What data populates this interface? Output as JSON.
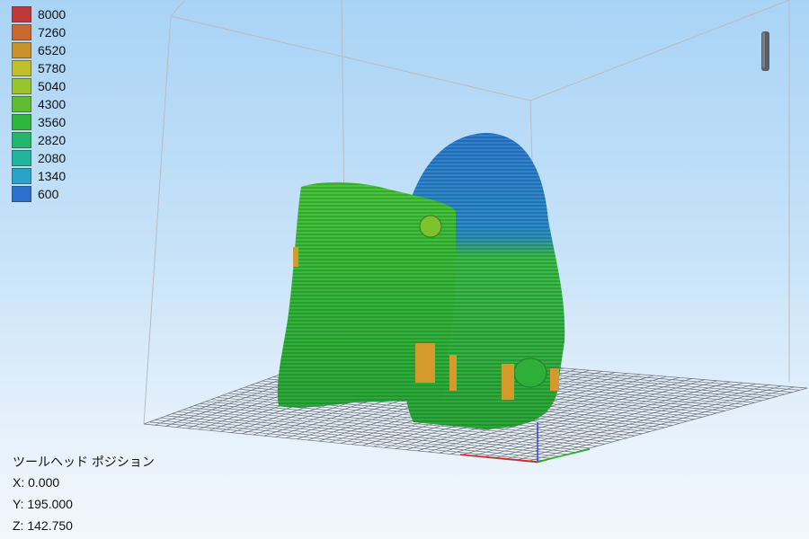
{
  "legend": {
    "items": [
      {
        "label": "8000",
        "color": "#c0393a"
      },
      {
        "label": "7260",
        "color": "#c9692d"
      },
      {
        "label": "6520",
        "color": "#c9912a"
      },
      {
        "label": "5780",
        "color": "#c3bf2b"
      },
      {
        "label": "5040",
        "color": "#98c42c"
      },
      {
        "label": "4300",
        "color": "#5cbe30"
      },
      {
        "label": "3560",
        "color": "#2fb63c"
      },
      {
        "label": "2820",
        "color": "#22b56b"
      },
      {
        "label": "2080",
        "color": "#21b59c"
      },
      {
        "label": "1340",
        "color": "#2aa3c8"
      },
      {
        "label": "600",
        "color": "#2c6fce"
      }
    ]
  },
  "tool_position": {
    "title": "ツールヘッド ポジション",
    "x": "X: 0.000",
    "y": "Y: 195.000",
    "z": "Z: 142.750"
  },
  "icons": {
    "handle": "scroll-handle-icon"
  },
  "colors": {
    "background_top": "#a9d3f5",
    "background_bottom": "#f2f7fc",
    "part_blue": "#2a7fcf",
    "part_green": "#3fbf36",
    "part_orange": "#d99a2b"
  }
}
